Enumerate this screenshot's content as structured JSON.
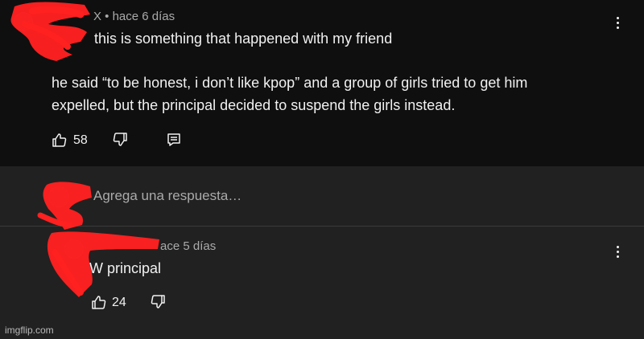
{
  "comment": {
    "meta": "X • hace 6 días",
    "lines": [
      "this is something that happened with my friend",
      "he said “to be honest, i don’t like kpop” and a group of girls tried to get him",
      "expelled, but the principal decided to suspend the girls instead."
    ],
    "like_count": "58",
    "icons": {
      "like": "thumbs-up-icon",
      "dislike": "thumbs-down-icon",
      "reply": "reply-icon",
      "more": "more-vertical-icon"
    }
  },
  "reply_box": {
    "placeholder": "Agrega una respuesta…"
  },
  "reply": {
    "meta": "ace 5 días",
    "text": "W principal",
    "like_count": "24"
  },
  "watermark": "imgflip.com",
  "colors": {
    "comment_background": "#0f0f0f",
    "page_background": "#212121",
    "redaction": "#ff2020",
    "text_primary": "#f1f1f1",
    "text_secondary": "#aaaaaa"
  }
}
